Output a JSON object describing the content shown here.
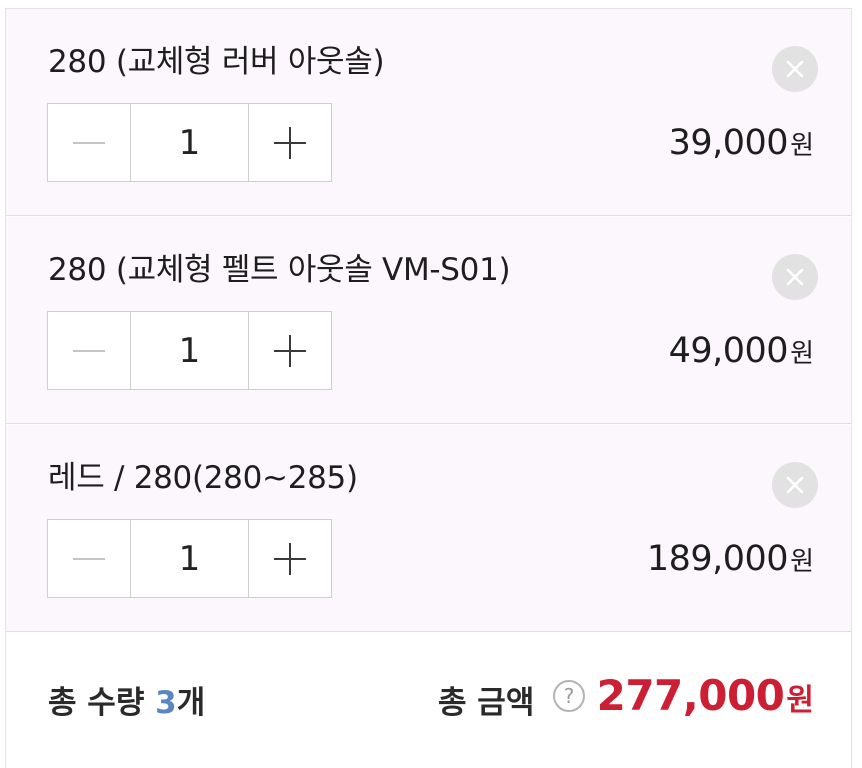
{
  "options": [
    {
      "name": "280 (교체형 러버 아웃솔)",
      "quantity": "1",
      "price": "39,000",
      "currency": "원"
    },
    {
      "name": "280 (교체형 펠트 아웃솔 VM-S01)",
      "quantity": "1",
      "price": "49,000",
      "currency": "원"
    },
    {
      "name": "레드 / 280(280~285)",
      "quantity": "1",
      "price": "189,000",
      "currency": "원"
    }
  ],
  "summary": {
    "total_qty_label": "총 수량",
    "total_qty_count": "3",
    "total_qty_unit": "개",
    "total_amount_label": "총 금액",
    "help_glyph": "?",
    "total_price": "277,000",
    "currency": "원"
  },
  "colors": {
    "option_bg": "#fcf7fc",
    "accent_price": "#cc1f33",
    "qty_count": "#5b86c5"
  },
  "icons": {
    "remove": "close-icon",
    "decrease": "minus-icon",
    "increase": "plus-icon",
    "help": "question-icon"
  }
}
